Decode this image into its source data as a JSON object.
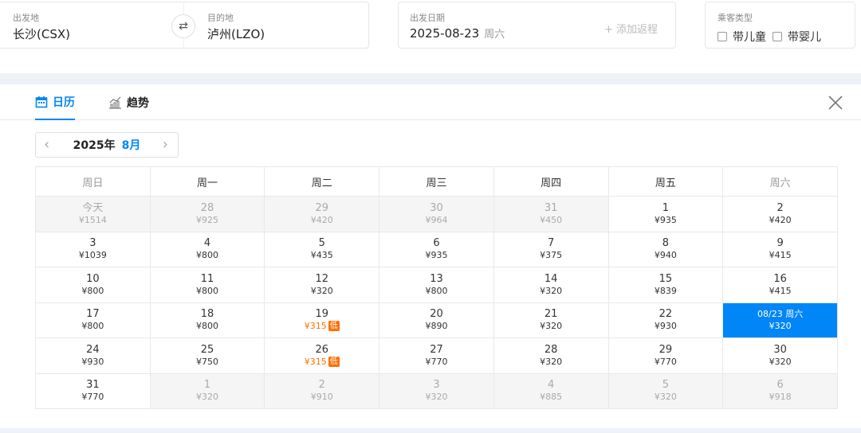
{
  "search": {
    "origin_label": "出发地",
    "origin_value": "长沙(CSX)",
    "destination_label": "目的地",
    "destination_value": "泸州(LZO)",
    "date_label": "出发日期",
    "date_value": "2025-08-23",
    "date_weekday": "周六",
    "add_return": "+ 添加返程",
    "passenger_label": "乘客类型",
    "with_child": "带儿童",
    "with_infant": "带婴儿"
  },
  "tabs": {
    "calendar": "日历",
    "trend": "趋势"
  },
  "month_nav": {
    "year": "2025年",
    "month": "8月"
  },
  "weekdays": [
    "周日",
    "周一",
    "周二",
    "周三",
    "周四",
    "周五",
    "周六"
  ],
  "low_tag": "低",
  "colors": {
    "accent": "#0086f6",
    "low_price": "#ff6f00"
  },
  "weeks": [
    [
      {
        "day": "今天",
        "price": "¥1514",
        "state": "out"
      },
      {
        "day": "28",
        "price": "¥925",
        "state": "out"
      },
      {
        "day": "29",
        "price": "¥420",
        "state": "out"
      },
      {
        "day": "30",
        "price": "¥964",
        "state": "out"
      },
      {
        "day": "31",
        "price": "¥450",
        "state": "out"
      },
      {
        "day": "1",
        "price": "¥935",
        "state": "normal"
      },
      {
        "day": "2",
        "price": "¥420",
        "state": "normal"
      }
    ],
    [
      {
        "day": "3",
        "price": "¥1039",
        "state": "normal"
      },
      {
        "day": "4",
        "price": "¥800",
        "state": "normal"
      },
      {
        "day": "5",
        "price": "¥435",
        "state": "normal"
      },
      {
        "day": "6",
        "price": "¥935",
        "state": "normal"
      },
      {
        "day": "7",
        "price": "¥375",
        "state": "normal"
      },
      {
        "day": "8",
        "price": "¥940",
        "state": "normal"
      },
      {
        "day": "9",
        "price": "¥415",
        "state": "normal"
      }
    ],
    [
      {
        "day": "10",
        "price": "¥800",
        "state": "normal"
      },
      {
        "day": "11",
        "price": "¥800",
        "state": "normal"
      },
      {
        "day": "12",
        "price": "¥320",
        "state": "normal"
      },
      {
        "day": "13",
        "price": "¥800",
        "state": "normal"
      },
      {
        "day": "14",
        "price": "¥320",
        "state": "normal"
      },
      {
        "day": "15",
        "price": "¥839",
        "state": "normal"
      },
      {
        "day": "16",
        "price": "¥415",
        "state": "normal"
      }
    ],
    [
      {
        "day": "17",
        "price": "¥800",
        "state": "normal"
      },
      {
        "day": "18",
        "price": "¥800",
        "state": "normal"
      },
      {
        "day": "19",
        "price": "¥315",
        "state": "low"
      },
      {
        "day": "20",
        "price": "¥890",
        "state": "normal"
      },
      {
        "day": "21",
        "price": "¥320",
        "state": "normal"
      },
      {
        "day": "22",
        "price": "¥930",
        "state": "normal"
      },
      {
        "day": "08/23 周六",
        "price": "¥320",
        "state": "selected"
      }
    ],
    [
      {
        "day": "24",
        "price": "¥930",
        "state": "normal"
      },
      {
        "day": "25",
        "price": "¥750",
        "state": "normal"
      },
      {
        "day": "26",
        "price": "¥315",
        "state": "low"
      },
      {
        "day": "27",
        "price": "¥770",
        "state": "normal"
      },
      {
        "day": "28",
        "price": "¥320",
        "state": "normal"
      },
      {
        "day": "29",
        "price": "¥770",
        "state": "normal"
      },
      {
        "day": "30",
        "price": "¥320",
        "state": "normal"
      }
    ],
    [
      {
        "day": "31",
        "price": "¥770",
        "state": "normal"
      },
      {
        "day": "1",
        "price": "¥320",
        "state": "out"
      },
      {
        "day": "2",
        "price": "¥910",
        "state": "out"
      },
      {
        "day": "3",
        "price": "¥320",
        "state": "out"
      },
      {
        "day": "4",
        "price": "¥885",
        "state": "out"
      },
      {
        "day": "5",
        "price": "¥320",
        "state": "out"
      },
      {
        "day": "6",
        "price": "¥918",
        "state": "out"
      }
    ]
  ]
}
